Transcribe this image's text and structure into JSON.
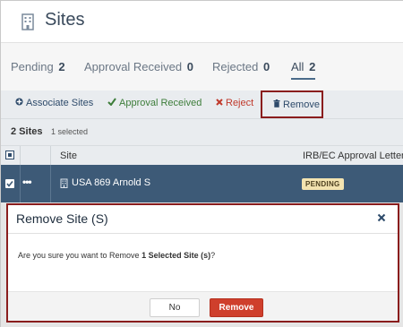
{
  "header": {
    "title": "Sites",
    "icon": "building-icon"
  },
  "tabs": [
    {
      "label": "Pending",
      "count": "2",
      "active": false
    },
    {
      "label": "Approval Received",
      "count": "0",
      "active": false
    },
    {
      "label": "Rejected",
      "count": "0",
      "active": false
    },
    {
      "label": "All",
      "count": "2",
      "active": true
    }
  ],
  "toolbar": {
    "associate": {
      "icon": "plus-circle-icon",
      "label": "Associate Sites"
    },
    "approval": {
      "icon": "check-icon",
      "label": "Approval Received"
    },
    "reject": {
      "icon": "x-icon",
      "label": "Reject"
    },
    "remove": {
      "icon": "trash-icon",
      "label": "Remove"
    }
  },
  "summary": {
    "sites_count": "2 Sites",
    "selected": "1 selected"
  },
  "table": {
    "columns": [
      "Site",
      "IRB/EC Approval Letter"
    ],
    "rows": [
      {
        "site": "USA 869 Arnold S",
        "status": "PENDING",
        "selected": true
      }
    ]
  },
  "dialog": {
    "title": "Remove Site (S)",
    "body_prefix": "Are you sure you want to Remove ",
    "body_bold": "1 Selected Site (s)",
    "body_suffix": "?",
    "no_label": "No",
    "remove_label": "Remove"
  },
  "colors": {
    "row_selected": "#3d5a77",
    "danger": "#cf3f2c",
    "success": "#3d7d3a",
    "highlight_border": "#8a1d1d",
    "pending_badge": "#f3e3b0"
  }
}
